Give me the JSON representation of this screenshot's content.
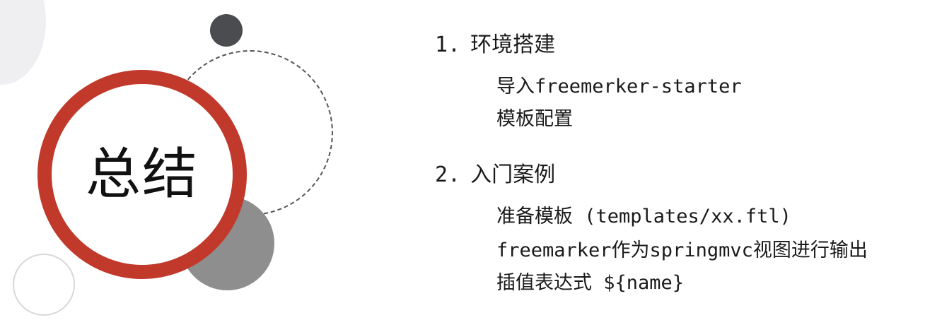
{
  "title": "总结",
  "sections": [
    {
      "number": "1.",
      "heading": "环境搭建",
      "items": [
        "导入freemerker-starter",
        "模板配置"
      ]
    },
    {
      "number": "2.",
      "heading": "入门案例",
      "items": [
        "准备模板 (templates/xx.ftl)",
        "freemarker作为springmvc视图进行输出",
        "插值表达式  ${name}"
      ]
    }
  ],
  "colors": {
    "accent": "#c0392b",
    "dark_circle": "#4a4c50",
    "gray_circle": "#8e8e8e"
  }
}
